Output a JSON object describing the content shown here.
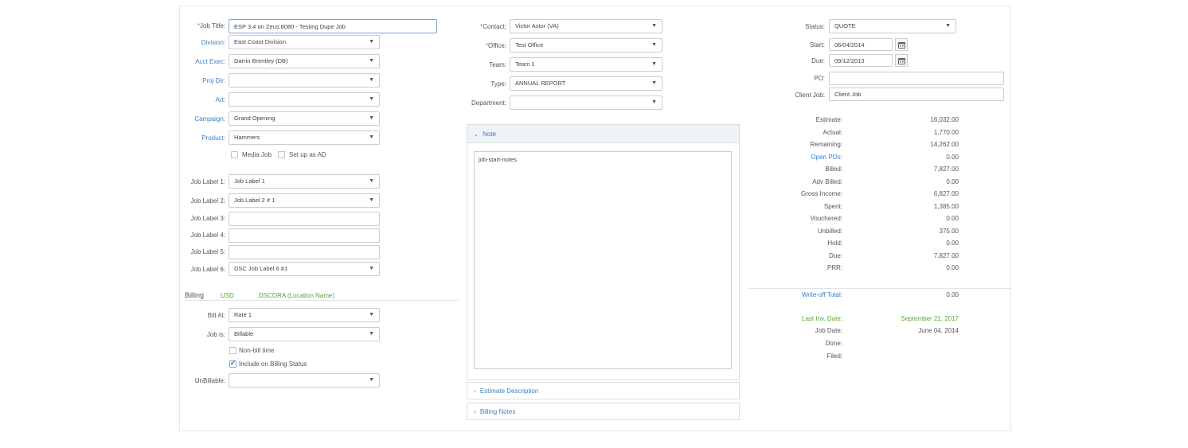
{
  "left": {
    "job_title_label": "Job Title:",
    "job_title_value": "ESP 3.4 on Zeus:8080 - Testing Dupe Job",
    "division_label": "Division:",
    "division_value": "East Coast Division",
    "acct_exec_label": "Acct Exec:",
    "acct_exec_value": "Darrin Brentley (DB)",
    "proj_dir_label": "Proj Dir:",
    "proj_dir_value": "",
    "art_label": "Art:",
    "art_value": "",
    "campaign_label": "Campaign:",
    "campaign_value": "Grand Opening",
    "product_label": "Product:",
    "product_value": "Hammers",
    "media_job_label": "Media Job",
    "set_up_ad_label": "Set up as AD",
    "job_labels": [
      {
        "label": "Job Label 1:",
        "value": "Job Label 1"
      },
      {
        "label": "Job Label 2:",
        "value": "Job Label 2 # 1"
      },
      {
        "label": "Job Label 3:",
        "value": ""
      },
      {
        "label": "Job Label 4:",
        "value": ""
      },
      {
        "label": "Job Label 5:",
        "value": ""
      },
      {
        "label": "Job Label 6:",
        "value": "DSC Job Label 6 #1"
      }
    ]
  },
  "billing": {
    "title": "Billing",
    "currency": "USD",
    "location": "DSCORA (Location Name)",
    "bill_at_label": "Bill At:",
    "bill_at_value": "Rate 1",
    "job_is_label": "Job is:",
    "job_is_value": "Billable",
    "non_bill_label": "Non-bill time",
    "non_bill_checked": false,
    "include_label": "Include on Billing Status",
    "include_checked": true,
    "unbillable_label": "UnBillable:",
    "unbillable_value": ""
  },
  "middle": {
    "contact_label": "Contact:",
    "contact_value": "Victor Astor (VA)",
    "office_label": "Office:",
    "office_value": "Test Office",
    "team_label": "Team:",
    "team_value": "Team 1",
    "type_label": "Type:",
    "type_value": "ANNUAL REPORT",
    "department_label": "Department:",
    "department_value": "",
    "note_title": "Note",
    "note_text": "job-start-notes",
    "estimate_desc_title": "Estimate Description",
    "billing_notes_title": "Billing Notes"
  },
  "right": {
    "status_label": "Status:",
    "status_value": "QUOTE",
    "start_label": "Start:",
    "start_value": "06/04/2014",
    "due_label": "Due:",
    "due_value": "09/12/2013",
    "po_label": "PO:",
    "po_value": "",
    "client_job_label": "Client Job:",
    "client_job_value": "Client Job",
    "summary": [
      {
        "label": "Estimate:",
        "value": "16,032.00",
        "link": false
      },
      {
        "label": "Actual:",
        "value": "1,770.00",
        "link": false
      },
      {
        "label": "Remaining:",
        "value": "14,262.00",
        "link": false
      },
      {
        "label": "Open POs:",
        "value": "0.00",
        "link": true
      },
      {
        "label": "Billed:",
        "value": "7,827.00",
        "link": false
      },
      {
        "label": "Adv Billed:",
        "value": "0.00",
        "link": false
      },
      {
        "label": "Gross Income:",
        "value": "6,827.00",
        "link": false
      },
      {
        "label": "Spent:",
        "value": "1,385.00",
        "link": false
      },
      {
        "label": "Vouchered:",
        "value": "0.00",
        "link": false
      },
      {
        "label": "Unbilled:",
        "value": "375.00",
        "link": false
      },
      {
        "label": "Hold:",
        "value": "0.00",
        "link": false
      },
      {
        "label": "Due:",
        "value": "7,827.00",
        "link": false
      },
      {
        "label": "PRR:",
        "value": "0.00",
        "link": false
      }
    ],
    "writeoff_label": "Write-off Total:",
    "writeoff_value": "0.00",
    "last_inv_label": "Last Inv. Date:",
    "last_inv_value": "September 21, 2017",
    "job_date_label": "Job Date:",
    "job_date_value": "June 04, 2014",
    "done_label": "Done:",
    "done_value": "",
    "filed_label": "Filed:",
    "filed_value": ""
  },
  "colors": {
    "link": "#3a7fc4",
    "required": "#d9534f",
    "green": "#5aa23a"
  },
  "icons": {
    "dropdown": "chevron-down-icon",
    "calendar": "calendar-icon",
    "collapse": "chevron-icon"
  }
}
